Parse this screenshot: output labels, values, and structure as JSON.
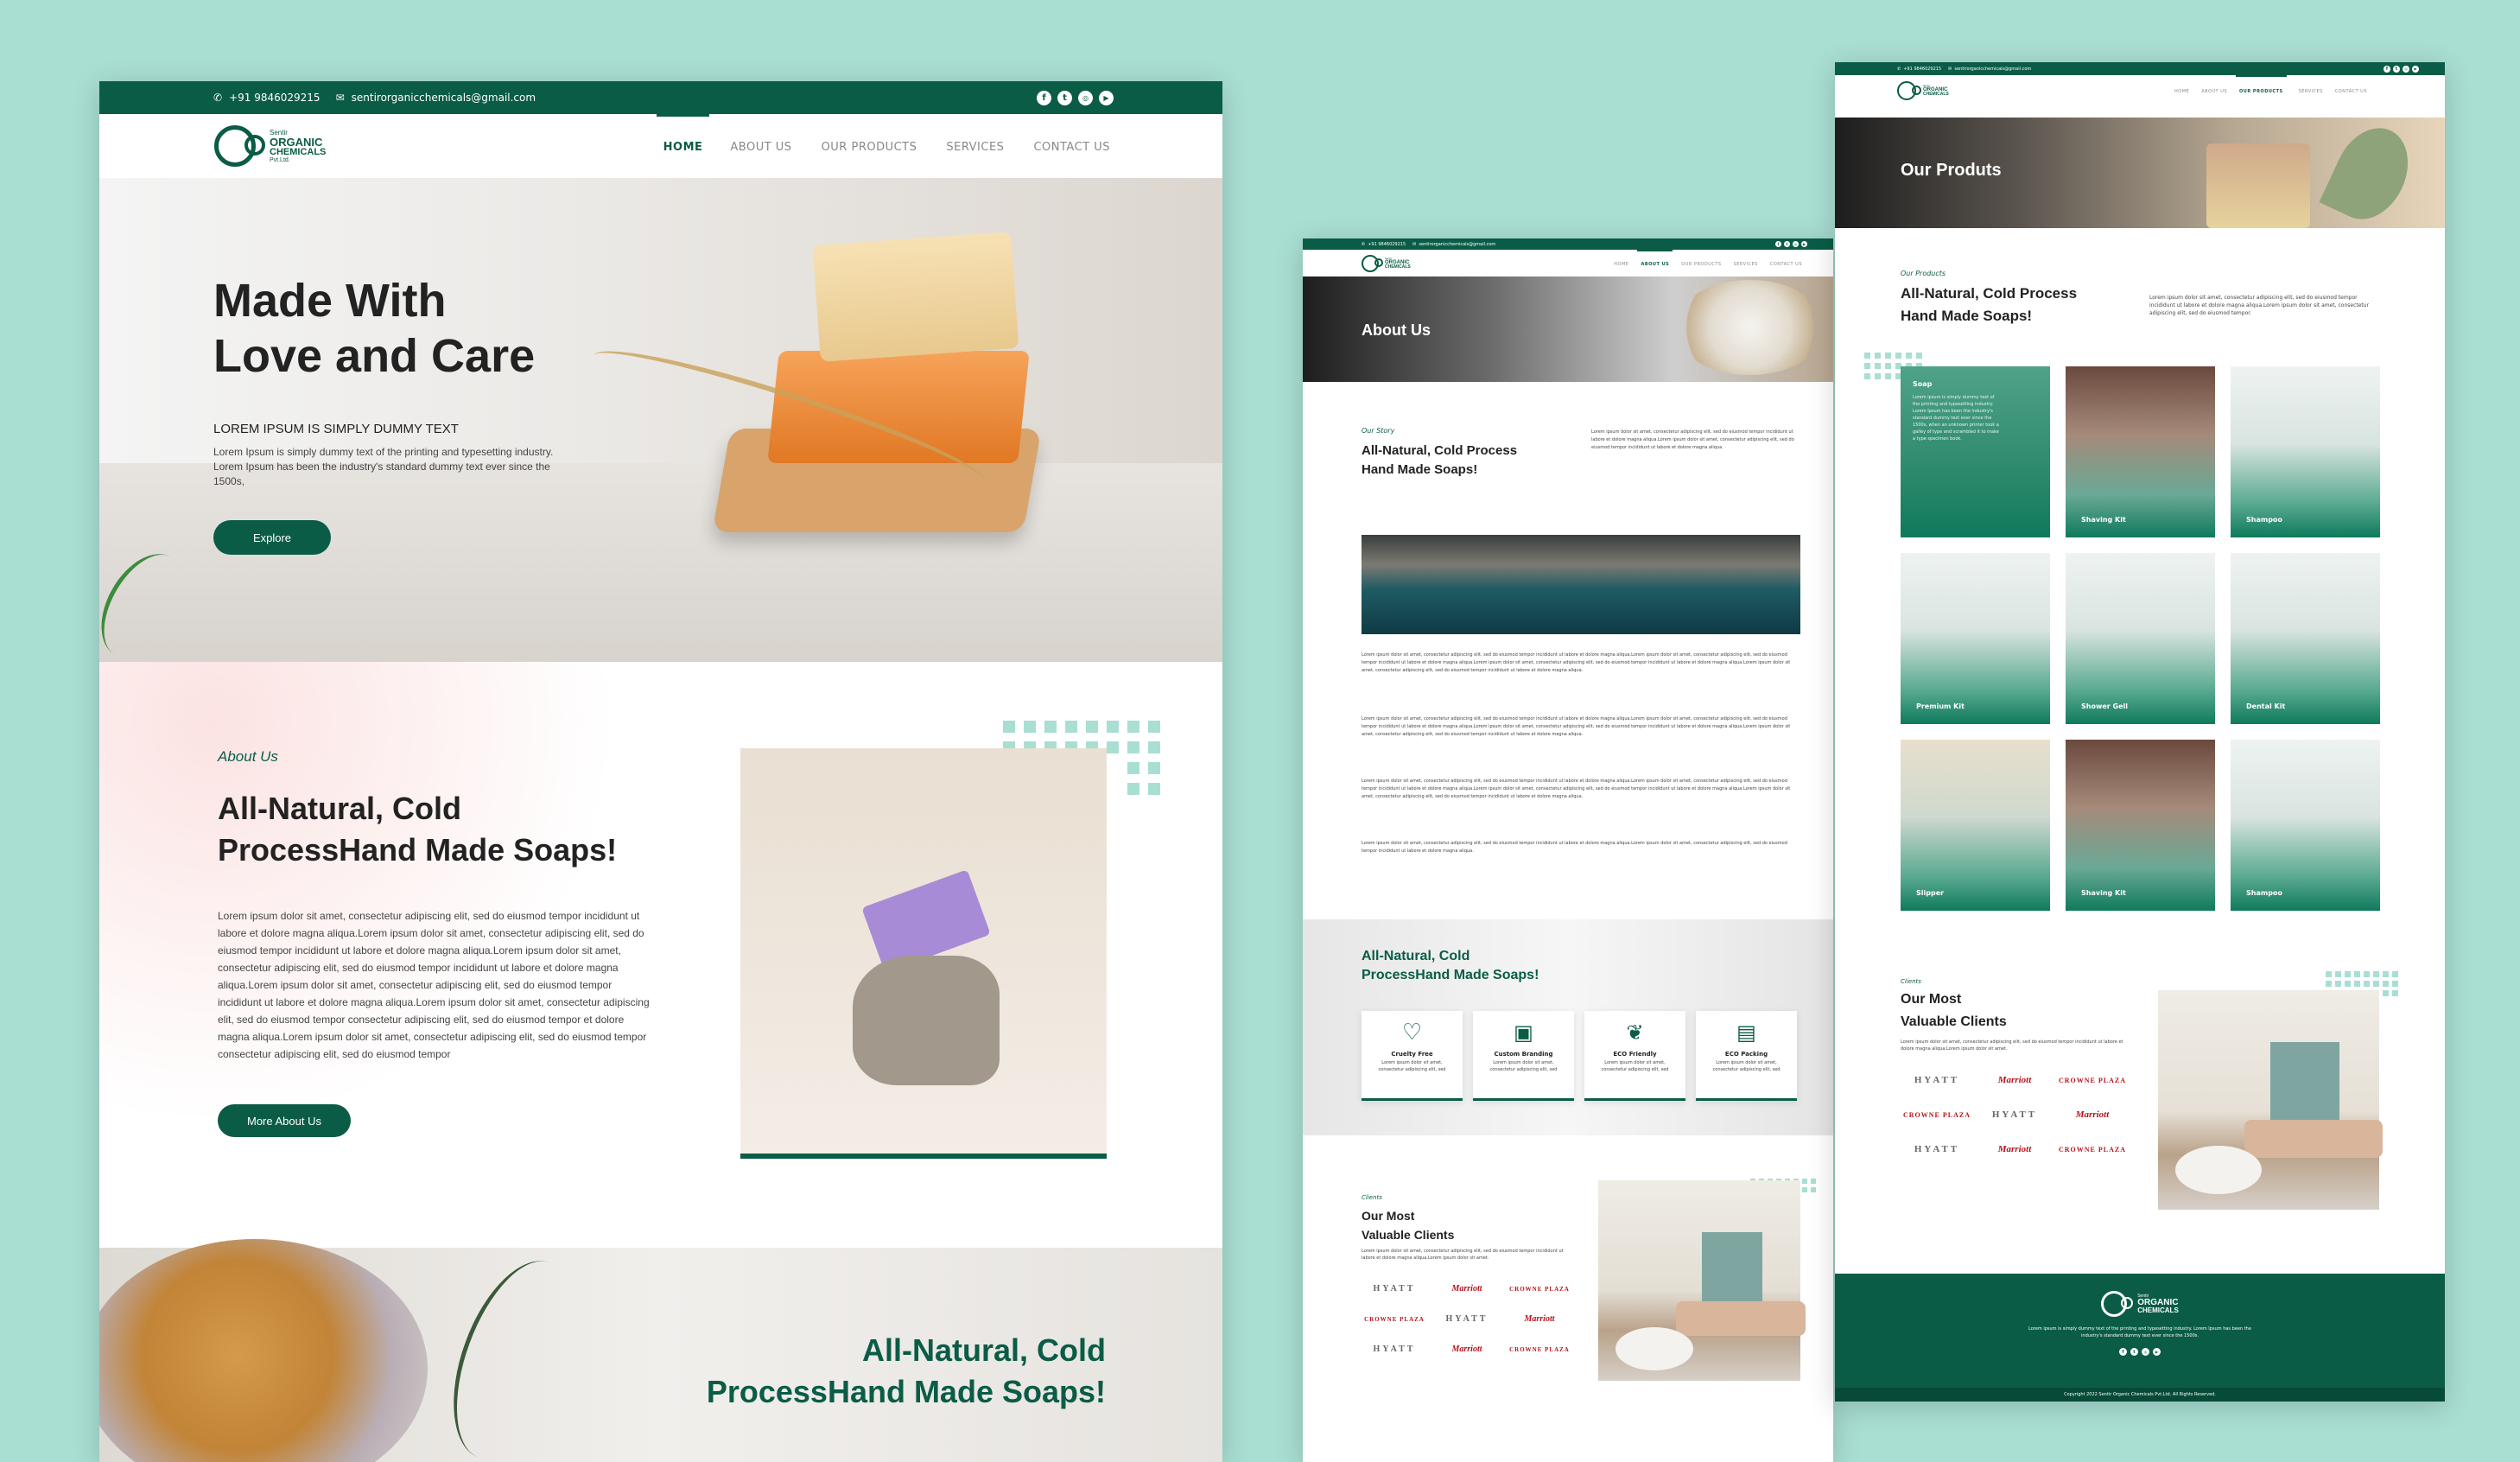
{
  "contact": {
    "phone": "+91 9846029215",
    "email": "sentirorganicchemicals@gmail.com"
  },
  "logo": {
    "line1": "Sentir",
    "line2": "ORGANIC",
    "line3": "CHEMICALS",
    "line4": "Pvt.Ltd."
  },
  "nav": {
    "home": "HOME",
    "about": "ABOUT US",
    "products": "OUR PRODUCTS",
    "services": "SERVICES",
    "contact": "CONTACT US"
  },
  "socials": [
    "f",
    "t",
    "ig",
    "yt"
  ],
  "home": {
    "hero_title_1": "Made With",
    "hero_title_2": "Love and Care",
    "hero_sub": "LOREM IPSUM IS SIMPLY DUMMY TEXT",
    "hero_text": "Lorem Ipsum is simply dummy text of the printing and typesetting industry. Lorem Ipsum has been the industry's standard dummy text ever since the 1500s,",
    "explore": "Explore",
    "about_tag": "About Us",
    "about_title_1": "All-Natural, Cold",
    "about_title_2": "ProcessHand Made Soaps!",
    "about_text": "Lorem ipsum dolor sit amet, consectetur adipiscing elit, sed do eiusmod tempor incididunt ut labore et dolore magna aliqua.Lorem ipsum dolor sit amet, consectetur adipiscing elit, sed do eiusmod tempor incididunt ut labore et dolore magna aliqua.Lorem ipsum dolor sit amet, consectetur adipiscing elit, sed do eiusmod tempor incididunt ut labore et dolore magna aliqua.Lorem ipsum dolor sit amet, consectetur adipiscing elit, sed do eiusmod tempor incididunt ut labore et dolore magna aliqua.Lorem ipsum dolor sit amet, consectetur adipiscing elit, sed do eiusmod tempor  consectetur adipiscing elit, sed do eiusmod tempor et dolore magna aliqua.Lorem ipsum dolor sit amet, consectetur adipiscing elit, sed do eiusmod tempor consectetur adipiscing elit, sed do eiusmod tempor",
    "more_about": "More About Us",
    "banner_1": "All-Natural, Cold",
    "banner_2": "ProcessHand Made Soaps!"
  },
  "about_page": {
    "title": "About Us",
    "tag": "Our Story",
    "h1": "All-Natural, Cold Process",
    "h2": "Hand Made Soaps!",
    "short": "Lorem ipsum dolor sit amet, consectetur adipiscing elit, sed do eiusmod tempor incididunt ut labore et dolore magna aliqua.Lorem ipsum dolor sit amet, consectetur adipiscing elit, sed do eiusmod tempor incididunt ut labore et dolore magna aliqua.",
    "long": "Lorem ipsum dolor sit amet, consectetur adipiscing elit, sed do eiusmod tempor incididunt ut labore et dolore magna aliqua.Lorem ipsum dolor sit amet, consectetur adipiscing elit, sed do eiusmod tempor incididunt ut labore et dolore magna aliqua.Lorem ipsum dolor sit amet, consectetur adipiscing elit, sed do eiusmod tempor incididunt ut labore et dolore magna aliqua.Lorem ipsum dolor sit amet, consectetur adipiscing elit, sed do eiusmod tempor incididunt ut labore et dolore magna aliqua.",
    "section_1": "All-Natural, Cold",
    "section_2": "ProcessHand Made Soaps!",
    "features": [
      {
        "title": "Cruelty Free",
        "text": "Lorem ipsum dolor sit amet, consectetur adipiscing elit, sed"
      },
      {
        "title": "Custom Branding",
        "text": "Lorem ipsum dolor sit amet, consectetur adipiscing elit, sed"
      },
      {
        "title": "ECO Friendly",
        "text": "Lorem ipsum dolor sit amet, consectetur adipiscing elit, sed"
      },
      {
        "title": "ECO Packing",
        "text": "Lorem ipsum dolor sit amet, consectetur adipiscing elit, sed"
      }
    ],
    "clients_tag": "Clients",
    "clients_1": "Our Most",
    "clients_2": "Valuable Clients",
    "clients_text": "Lorem ipsum dolor sit amet, consectetur adipiscing elit, sed do eiusmod tempor incididunt ut labore et dolore magna aliqua.Lorem ipsum dolor sit amet."
  },
  "brands": [
    "HYATT",
    "Marriott",
    "CROWNE PLAZA",
    "CROWNE PLAZA",
    "HYATT",
    "Marriott",
    "HYATT",
    "Marriott",
    "CROWNE PLAZA"
  ],
  "products_page": {
    "title": "Our Produts",
    "tag": "Our Products",
    "h1": "All-Natural, Cold Process",
    "h2": "Hand Made Soaps!",
    "text": "Lorem ipsum dolor sit amet, consectetur adipiscing elit, sed do eiusmod tempor incididunt ut labore et dolore magna aliqua.Lorem ipsum dolor sit amet, consectetur adipiscing elit, sed do eiusmod tempor.",
    "items": [
      "Soap",
      "Shaving Kit",
      "Shampoo",
      "Premium Kit",
      "Shower Gell",
      "Dental Kit",
      "Slipper",
      "Shaving Kit",
      "Shampoo"
    ],
    "soap_text": "Lorem ipsum is simply dummy text of the printing and typesetting industry. Lorem Ipsum has been the industry's standard dummy text ever since the 1500s, when an unknown printer took a galley of type and scrambled it to make a type specimen book.",
    "clients_tag": "Clients",
    "clients_1": "Our Most",
    "clients_2": "Valuable Clients",
    "clients_text": "Lorem ipsum dolor sit amet, consectetur adipiscing elit, sed do eiusmod tempor incididunt ut labore et dolore magna aliqua.Lorem ipsum dolor sit amet.",
    "footer_text": "Lorem ipsum is simply dummy text of the printing and typesetting industry. Lorem Ipsum has been the industry's standard dummy text ever since the 1500s.",
    "copyright": "Copyright 2022 Sentir Organic Chemicals Pvt.Ltd. All Rights Reserved."
  }
}
